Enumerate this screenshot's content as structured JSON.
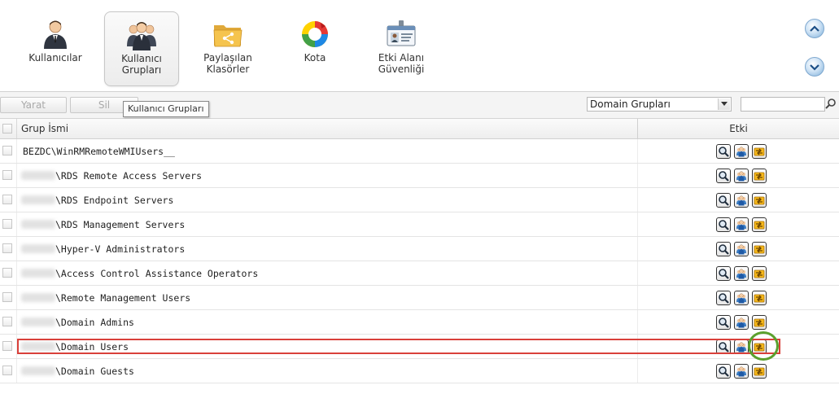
{
  "nav": {
    "items": [
      {
        "label": "Kullanıcılar",
        "icon": "user-icon"
      },
      {
        "label": "Kullanıcı\nGrupları",
        "icon": "user-group-icon",
        "active": true
      },
      {
        "label": "Paylaşılan\nKlasörler",
        "icon": "shared-folder-icon"
      },
      {
        "label": "Kota",
        "icon": "quota-pie-icon"
      },
      {
        "label": "Etki Alanı\nGüvenliği",
        "icon": "domain-security-icon"
      }
    ],
    "scroll_up_icon": "chevron-up-icon",
    "scroll_down_icon": "chevron-down-icon"
  },
  "toolbar": {
    "create_label": "Yarat",
    "delete_label": "Sil",
    "tooltip": "Kullanıcı Grupları",
    "filter_selected": "Domain Grupları",
    "search_value": ""
  },
  "grid": {
    "col_name": "Grup İsmi",
    "col_action": "Etki",
    "rows": [
      {
        "name": "BEZDC\\WinRMRemoteWMIUsers__",
        "redacted_prefix": false
      },
      {
        "name": "\\RDS Remote Access Servers",
        "redacted_prefix": true
      },
      {
        "name": "\\RDS Endpoint Servers",
        "redacted_prefix": true
      },
      {
        "name": "\\RDS Management Servers",
        "redacted_prefix": true
      },
      {
        "name": "\\Hyper-V Administrators",
        "redacted_prefix": true
      },
      {
        "name": "\\Access Control Assistance Operators",
        "redacted_prefix": true
      },
      {
        "name": "\\Remote Management Users",
        "redacted_prefix": true
      },
      {
        "name": "\\Domain Admins",
        "redacted_prefix": true
      },
      {
        "name": "\\Domain Users",
        "redacted_prefix": true
      },
      {
        "name": "\\Domain Guests",
        "redacted_prefix": true
      }
    ],
    "action_icons": [
      "view-details-icon",
      "members-icon",
      "permissions-icon"
    ]
  },
  "colors": {
    "highlight_row": "#d9403a",
    "highlight_action": "#5aa02c"
  }
}
